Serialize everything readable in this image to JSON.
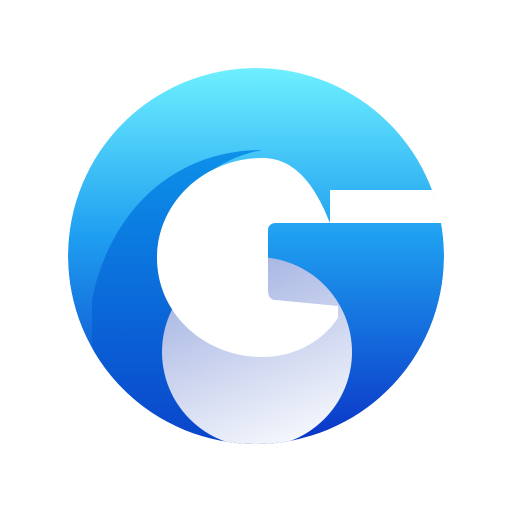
{
  "logo": {
    "icon": "g-letter-logo",
    "colors": {
      "gradient_top": "#6ef0ff",
      "gradient_mid": "#1e9ef0",
      "gradient_bottom": "#0a33c6",
      "inner_swoosh_top": "#0a8ee8",
      "inner_swoosh_bottom": "#0a3fc8",
      "lower_disc_top": "#9eaee0",
      "lower_disc_bottom": "#f4f6fc",
      "background": "#ffffff"
    }
  }
}
